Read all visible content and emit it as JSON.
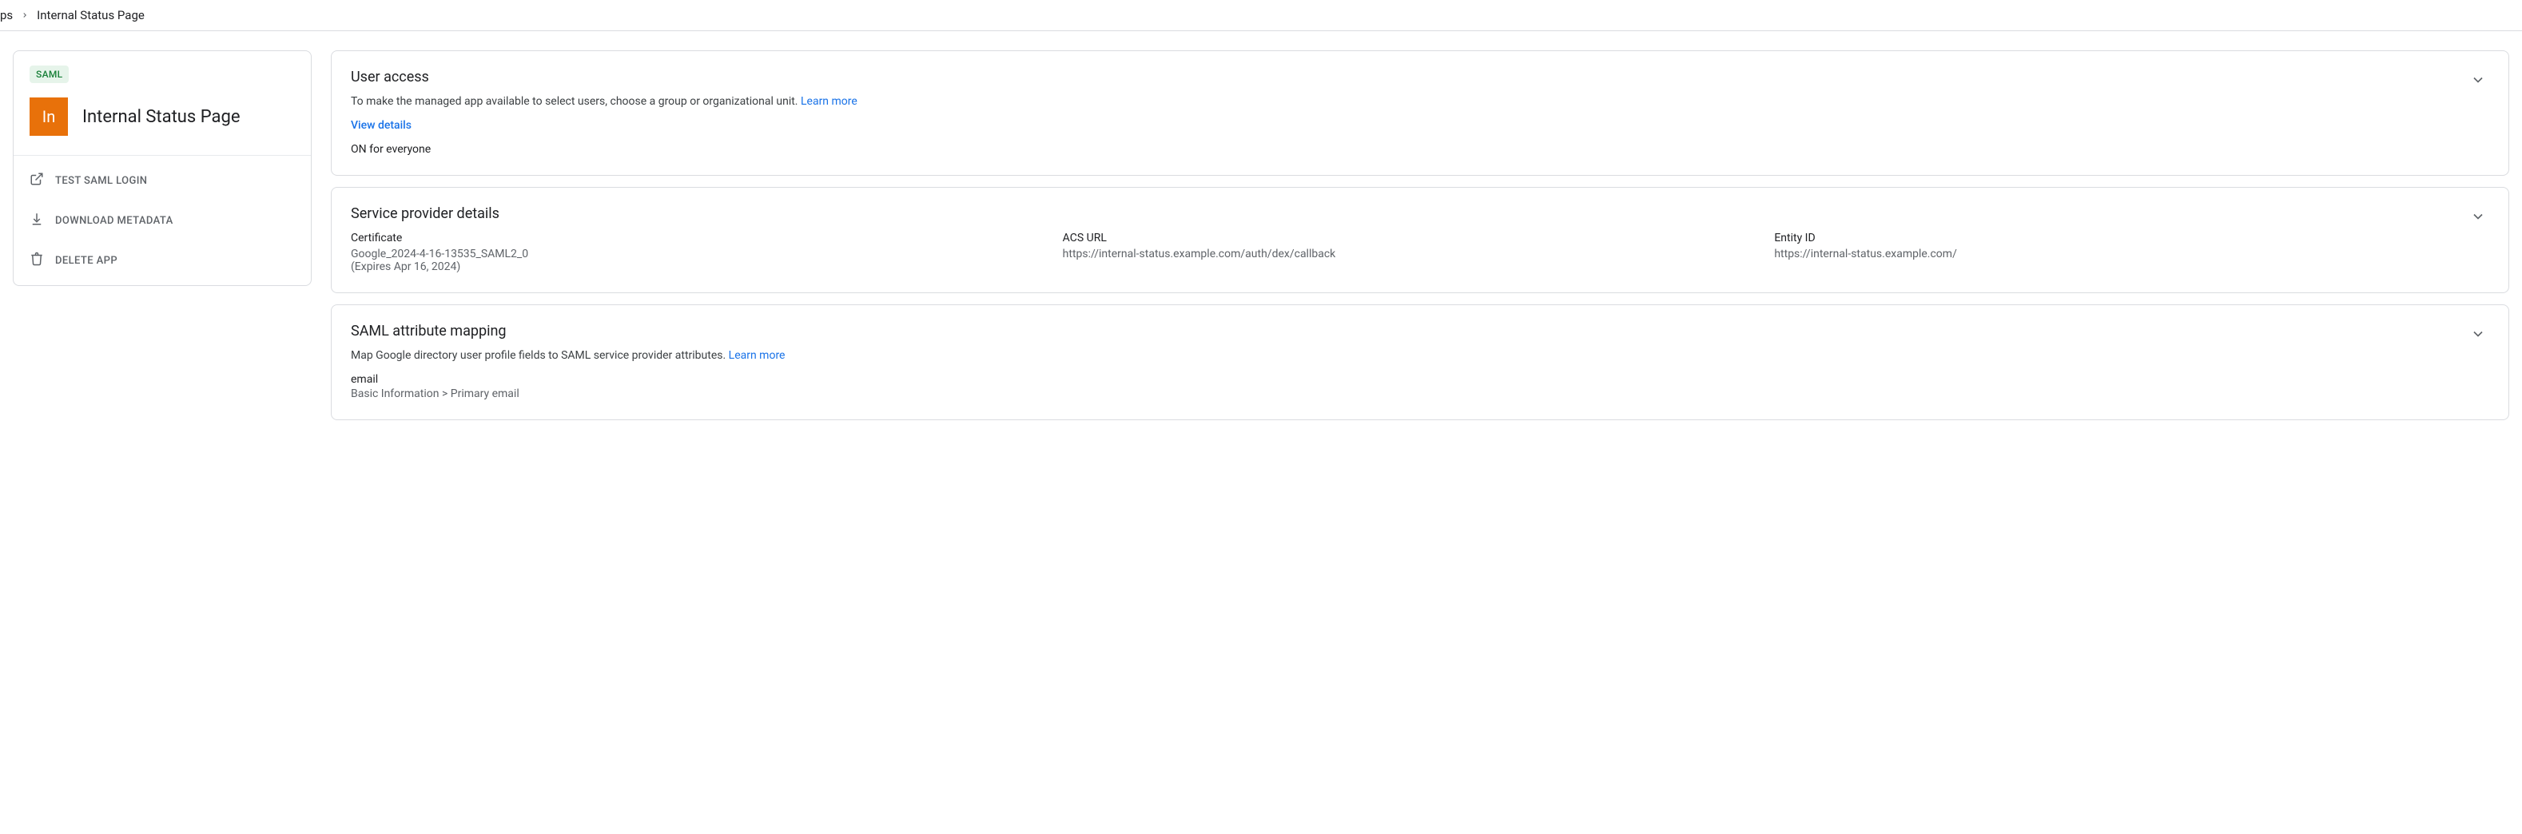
{
  "breadcrumb": {
    "parent_fragment": "ps",
    "current": "Internal Status Page"
  },
  "sidebar": {
    "badge": "SAML",
    "logo_text": "In",
    "app_title": "Internal Status Page",
    "actions": {
      "test_login": "TEST SAML LOGIN",
      "download_metadata": "DOWNLOAD METADATA",
      "delete_app": "DELETE APP"
    }
  },
  "user_access": {
    "title": "User access",
    "description": "To make the managed app available to select users, choose a group or organizational unit. ",
    "learn_more": "Learn more",
    "view_details": "View details",
    "status": "ON for everyone"
  },
  "service_provider": {
    "title": "Service provider details",
    "cert_label": "Certificate",
    "cert_value": "Google_2024-4-16-13535_SAML2_0",
    "cert_expires": "(Expires Apr 16, 2024)",
    "acs_label": "ACS URL",
    "acs_value": "https://internal-status.example.com/auth/dex/callback",
    "entity_label": "Entity ID",
    "entity_value": "https://internal-status.example.com/"
  },
  "attribute_mapping": {
    "title": "SAML attribute mapping",
    "description": "Map Google directory user profile fields to SAML service provider attributes. ",
    "learn_more": "Learn more",
    "attr_name": "email",
    "attr_path": "Basic Information > Primary email"
  }
}
